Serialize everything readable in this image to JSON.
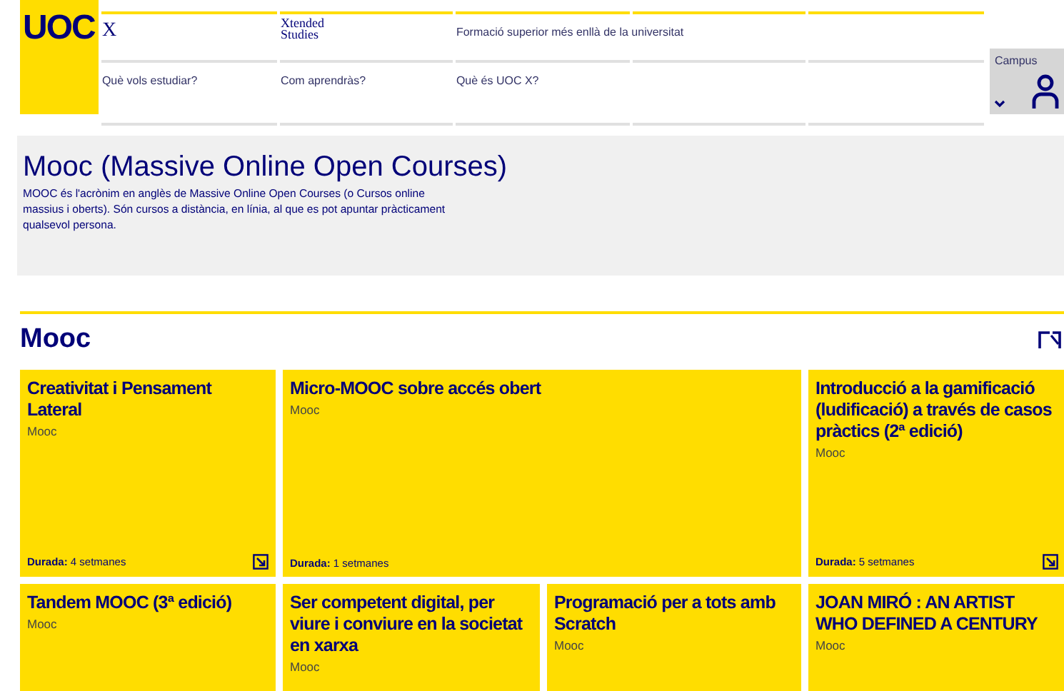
{
  "header": {
    "logo": "UOC",
    "brand": "X",
    "top_links": [
      "Xtended Studies",
      "Formació superior més enllà de la universitat"
    ],
    "nav": [
      {
        "label": "Què vols estudiar?"
      },
      {
        "label": "Com aprendràs?"
      },
      {
        "label": "Què és UOC X?"
      }
    ],
    "campus": "Campus"
  },
  "intro": {
    "title": "Mooc (Massive Online Open Courses)",
    "text": "MOOC és l'acrònim en anglès de Massive Online Open Courses (o Cursos online massius i oberts). Són cursos a distància, en línia, al que es pot apuntar pràcticament qualsevol persona."
  },
  "section": {
    "title": "Mooc",
    "courses": [
      {
        "kind": "normal",
        "title": "Creativitat i Pensament Lateral",
        "type": "Mooc",
        "duration_label": "Durada:",
        "duration": "4 setmanes",
        "link_icon": true
      },
      {
        "kind": "wide",
        "title": "Micro-MOOC sobre accés obert",
        "type": "Mooc",
        "duration_label": "Durada:",
        "duration": "1 setmanes",
        "link_icon": false
      },
      {
        "kind": "normal",
        "title": "Introducció a la gamificació (ludificació) a través de casos pràctics (2ª edició)",
        "type": "Mooc",
        "duration_label": "Durada:",
        "duration": "5 setmanes",
        "link_icon": true
      },
      {
        "kind": "normal",
        "title": "Tandem MOOC (3ª edició)",
        "type": "Mooc"
      },
      {
        "kind": "normal",
        "title": "Ser competent digital, per viure i conviure en la societat en xarxa",
        "type": "Mooc"
      },
      {
        "kind": "normal",
        "title": "Programació per a tots amb Scratch",
        "type": "Mooc"
      },
      {
        "kind": "normal",
        "title": "JOAN MIRÓ : AN ARTIST WHO DEFINED A CENTURY",
        "type": "Mooc"
      }
    ]
  }
}
